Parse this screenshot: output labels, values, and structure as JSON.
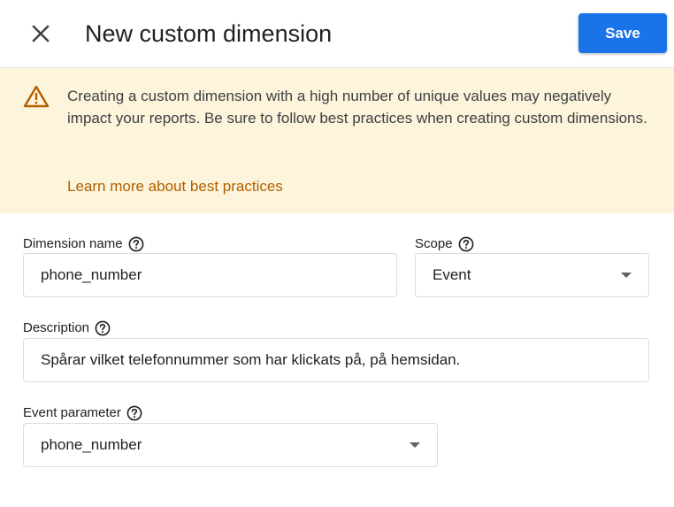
{
  "header": {
    "title": "New custom dimension",
    "save_label": "Save"
  },
  "banner": {
    "message": "Creating a custom dimension with a high number of unique values may negatively impact your reports. Be sure to follow best practices when creating custom dimensions.",
    "link_label": "Learn more about best practices"
  },
  "form": {
    "dimension_name": {
      "label": "Dimension name",
      "value": "phone_number"
    },
    "scope": {
      "label": "Scope",
      "value": "Event"
    },
    "description": {
      "label": "Description",
      "value": "Spårar vilket telefonnummer som har klickats på, på hemsidan."
    },
    "event_parameter": {
      "label": "Event parameter",
      "value": "phone_number"
    }
  },
  "colors": {
    "primary": "#1a73e8",
    "banner_bg": "#fdf4dc",
    "link": "#b06000",
    "warning_icon": "#b06000"
  },
  "icons": {
    "close": "close-icon",
    "warning": "warning-icon",
    "help": "help-circle-icon",
    "dropdown": "chevron-down-icon"
  }
}
